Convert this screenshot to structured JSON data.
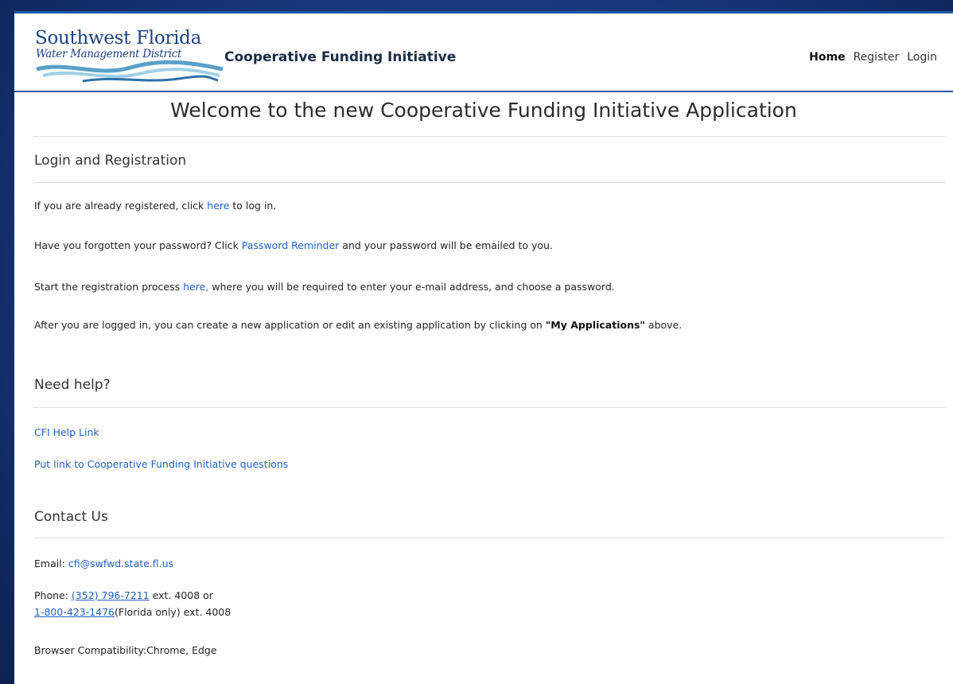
{
  "logo": {
    "line1": "Southwest Florida",
    "line2": "Water Management District",
    "wave_colors": [
      "#5aa0c8",
      "#9fd0e6",
      "#2e6fa8"
    ]
  },
  "brand": {
    "title": "Cooperative Funding Initiative"
  },
  "nav": {
    "home": "Home",
    "register": "Register",
    "login": "Login"
  },
  "welcome": "Welcome to the new Cooperative Funding Initiative Application",
  "login_section": {
    "title": "Login and Registration",
    "p1": {
      "pre": "If you are already registered, click ",
      "link": "here",
      "post": " to log in."
    },
    "p2": {
      "pre": "Have you forgotten your password? Click ",
      "link": "Password Reminder",
      "post": " and your password will be emailed to you."
    },
    "p3": {
      "pre": "Start the registration process ",
      "link": "here,",
      "post": " where you will be required to enter your e-mail address, and choose a password."
    },
    "p4": {
      "pre": "After you are logged in, you can create a new application or edit an existing application by clicking on ",
      "bold": "\"My Applications\"",
      "post": " above."
    }
  },
  "help_section": {
    "title": "Need help?",
    "link1": "CFI Help Link",
    "link2": "Put link to Cooperative Funding Initiative questions"
  },
  "contact_section": {
    "title": "Contact Us",
    "email_label": "Email: ",
    "email": "cfi@swfwd.state.fl.us",
    "phone_label": "Phone: ",
    "phone1": "(352) 796-7211",
    "phone1_ext": " ext. 4008 or",
    "phone2": "1-800-423-1476",
    "phone2_ext": "(Florida only) ext. 4008",
    "browser": "Browser Compatibility:Chrome, Edge"
  },
  "colors": {
    "accent": "#1e5aa8",
    "link": "#1f5fbf",
    "frame": "#17367a"
  }
}
